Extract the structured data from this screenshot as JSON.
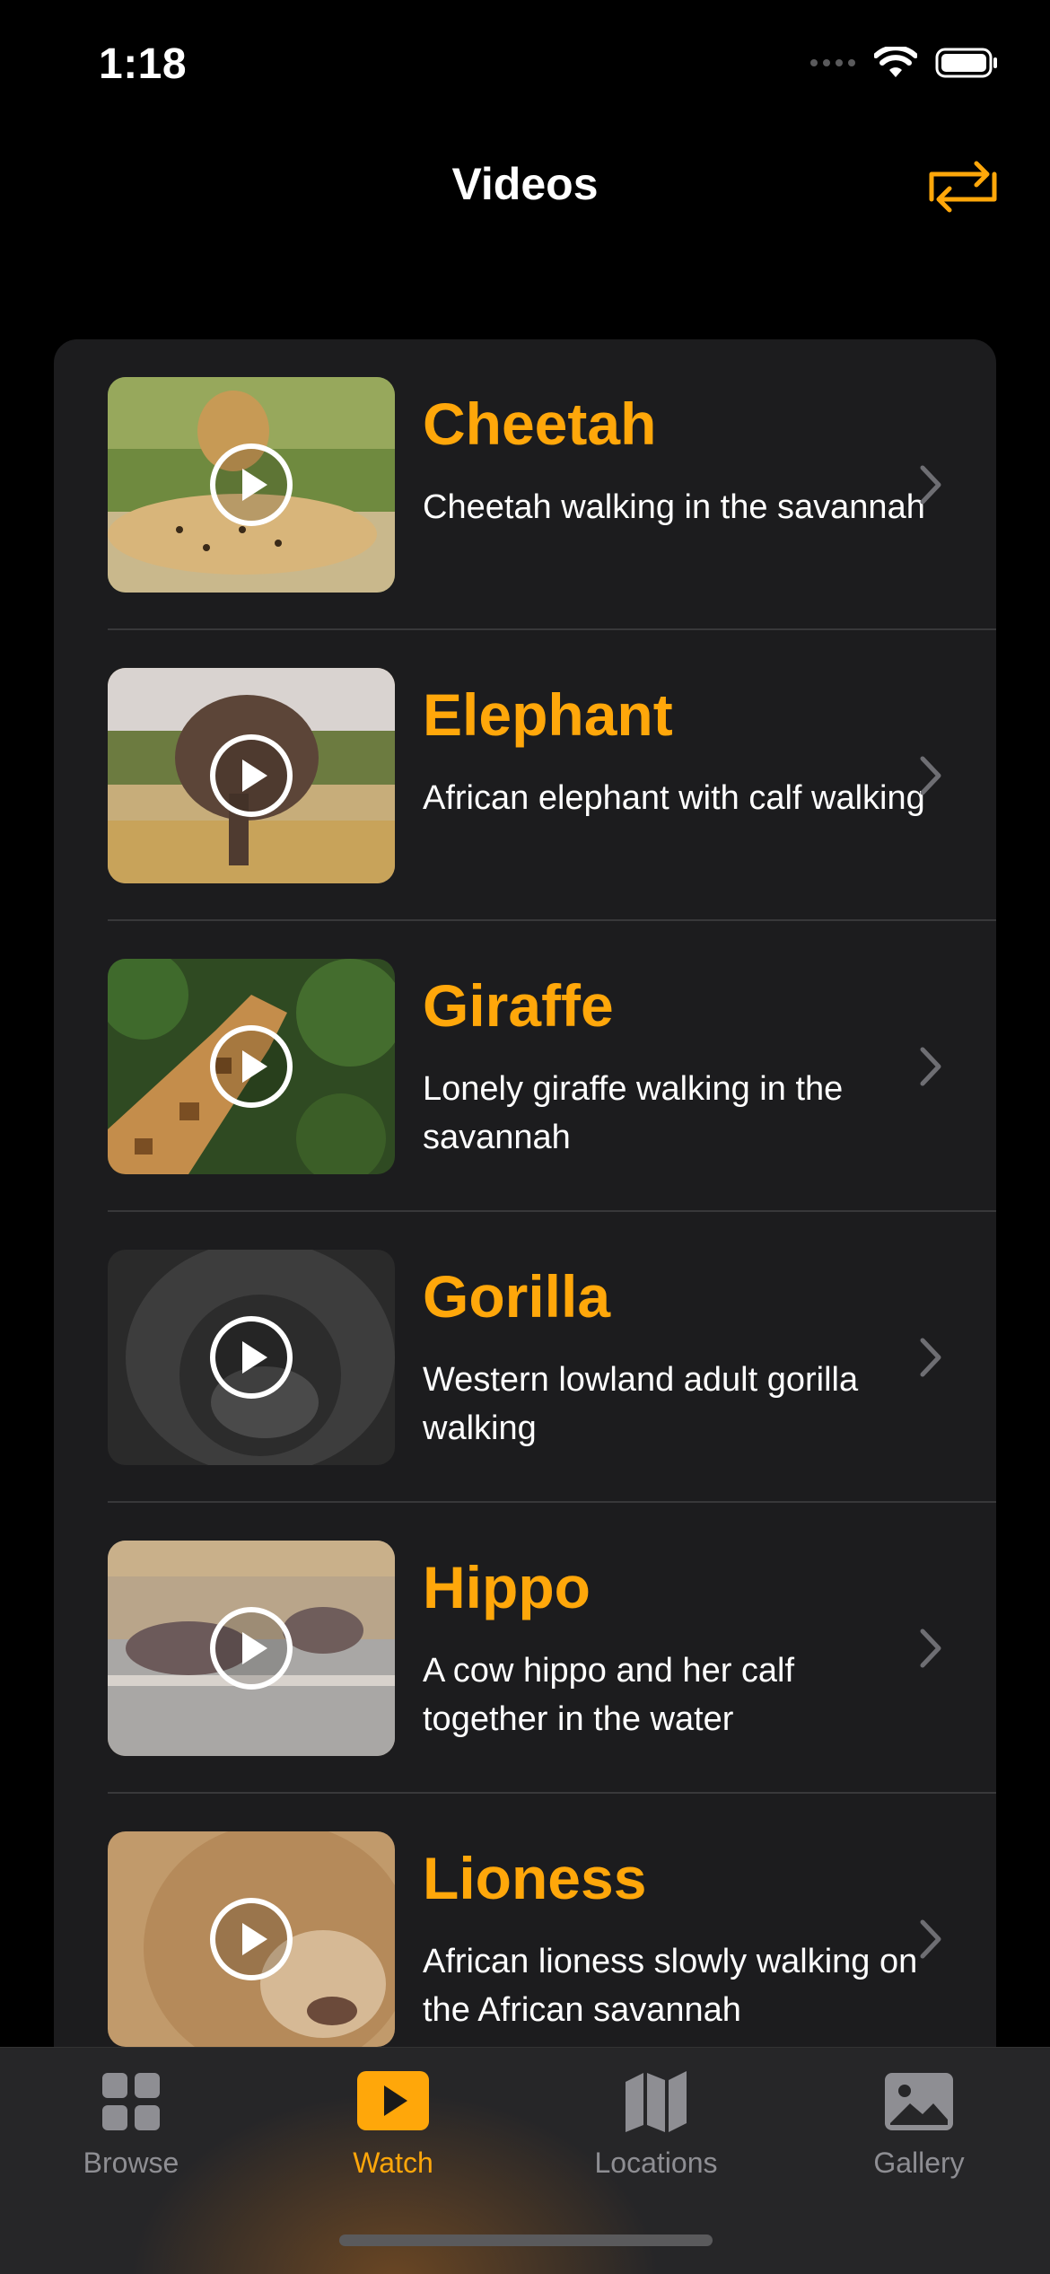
{
  "status_bar": {
    "time": "1:18"
  },
  "nav": {
    "title": "Videos",
    "action_icon": "repeat-icon"
  },
  "accent_color": "#ffa70a",
  "videos": [
    {
      "title": "Cheetah",
      "description": "Cheetah walking in the savannah"
    },
    {
      "title": "Elephant",
      "description": "African elephant with calf walking"
    },
    {
      "title": "Giraffe",
      "description": "Lonely giraffe walking in the savannah"
    },
    {
      "title": "Gorilla",
      "description": "Western lowland adult gorilla walking"
    },
    {
      "title": "Hippo",
      "description": "A cow hippo and her calf together in the water"
    },
    {
      "title": "Lioness",
      "description": "African lioness slowly walking on the African savannah"
    }
  ],
  "tabs": [
    {
      "label": "Browse",
      "icon": "grid-icon",
      "active": false
    },
    {
      "label": "Watch",
      "icon": "play-rectangle-icon",
      "active": true
    },
    {
      "label": "Locations",
      "icon": "map-icon",
      "active": false
    },
    {
      "label": "Gallery",
      "icon": "photo-icon",
      "active": false
    }
  ]
}
